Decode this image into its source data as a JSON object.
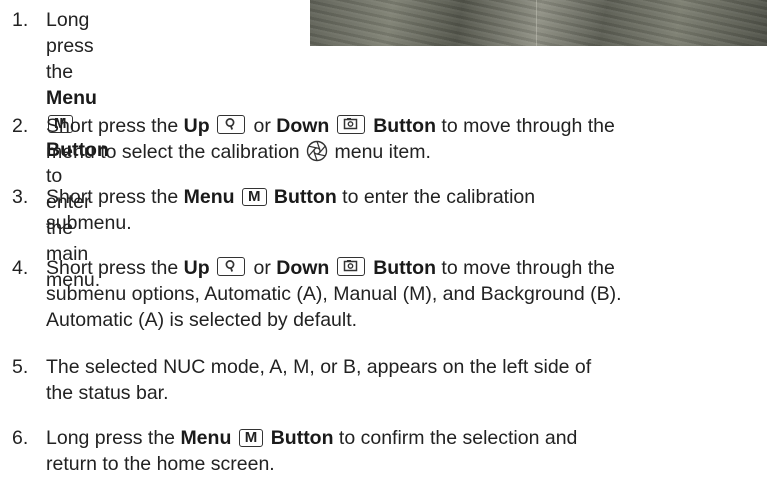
{
  "steps": [
    {
      "num": "1.",
      "a": "Long press the ",
      "b": "Menu",
      "key": "M",
      "c": "Button",
      "d": " to enter",
      "line2": "the main menu."
    },
    {
      "num": "2.",
      "a": "Short press the ",
      "b1": "Up",
      "mid": " or ",
      "b2": "Down",
      "c": "Button",
      "d": " to move through the",
      "e": "menu to select the calibration ",
      "f": " menu item."
    },
    {
      "num": "3.",
      "a": "Short press the ",
      "b": "Menu",
      "key": "M",
      "c": "Button",
      "d": " to enter the calibration",
      "line2": "submenu."
    },
    {
      "num": "4.",
      "a": "Short press the ",
      "b1": "Up",
      "mid": " or ",
      "b2": "Down",
      "c": "Button",
      "d": " to move through the",
      "line2": "submenu options, Automatic (A), Manual (M), and Background (B).",
      "line3": "Automatic (A) is selected by default."
    },
    {
      "num": "5.",
      "line1": "The selected NUC mode, A, M, or B, appears on the left side of",
      "line2": "the status bar."
    },
    {
      "num": "6.",
      "a": "Long press the ",
      "b": "Menu",
      "key": "M",
      "c": "Button",
      "d": " to confirm the selection and",
      "line2": "return to the home screen."
    }
  ],
  "icons": {
    "up": "zoom-magnifier-icon",
    "down": "camera-icon",
    "calibration": "aperture-icon"
  }
}
